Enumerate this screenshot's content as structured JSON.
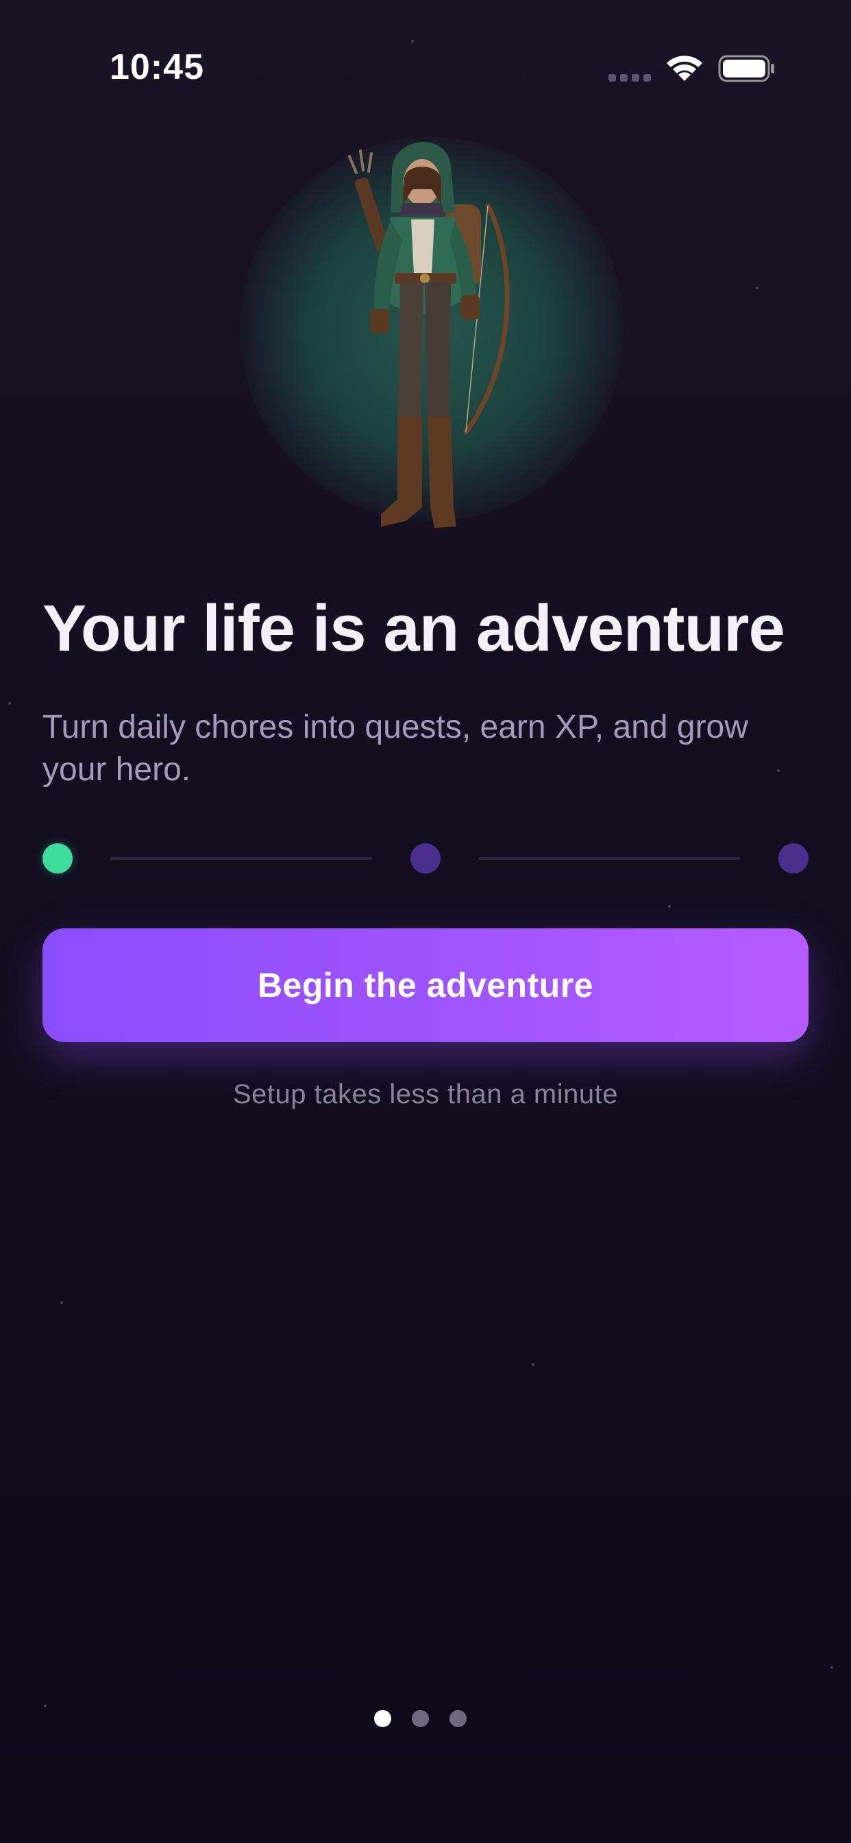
{
  "status_bar": {
    "time": "10:45"
  },
  "onboarding": {
    "title": "Your life is an adventure",
    "subtitle": "Turn daily chores into quests, earn XP, and grow your hero.",
    "progress": {
      "current_step": 1,
      "total_steps": 3,
      "active_color": "#3ddc9c",
      "inactive_color": "#4a2f8f"
    },
    "cta_label": "Begin the adventure",
    "hint": "Setup takes less than a minute"
  },
  "pager": {
    "current_page": 1,
    "total_pages": 3,
    "active_color": "#ffffff",
    "inactive_color": "#6e6880"
  },
  "colors": {
    "background": "#150f22",
    "accent_start": "#8a4dfc",
    "accent_end": "#b55bff",
    "hero_glow": "#265c52"
  },
  "icons": {
    "signal": "cellular-signal-icon",
    "wifi": "wifi-icon",
    "battery": "battery-icon",
    "hero": "ranger-hero-illustration"
  }
}
